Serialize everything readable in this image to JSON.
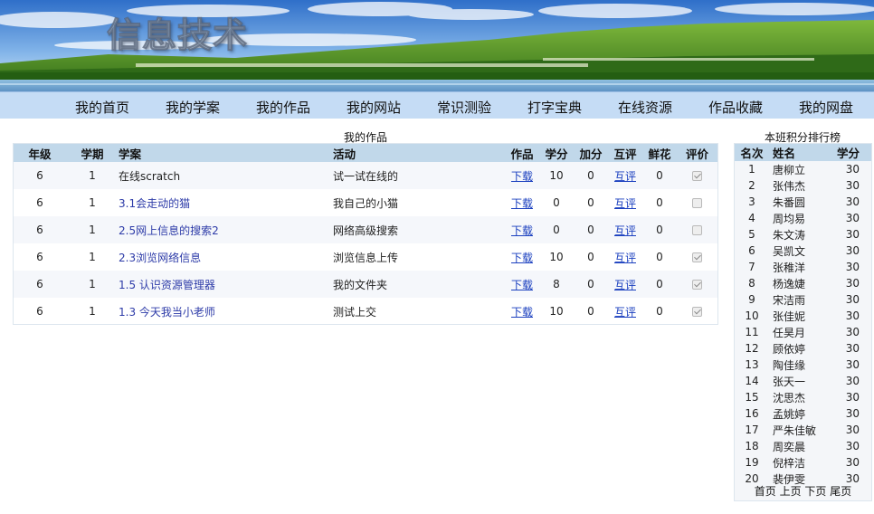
{
  "banner": {
    "title": "信息技术"
  },
  "nav": {
    "items": [
      "我的首页",
      "我的学案",
      "我的作品",
      "我的网站",
      "常识测验",
      "打字宝典",
      "在线资源",
      "作品收藏",
      "我的网盘"
    ]
  },
  "works": {
    "caption": "我的作品",
    "columns": [
      "年级",
      "学期",
      "学案",
      "活动",
      "作品",
      "学分",
      "加分",
      "互评",
      "鲜花",
      "评价"
    ],
    "rows": [
      {
        "grade": "6",
        "term": "1",
        "lesson": "在线scratch",
        "activity": "试一试在线的",
        "download": "下载",
        "credit": "10",
        "bonus": "0",
        "review": "互评",
        "flowers": "0",
        "rated": true
      },
      {
        "grade": "6",
        "term": "1",
        "lesson": "3.1会走动的猫",
        "activity": "我自己的小猫",
        "download": "下载",
        "credit": "0",
        "bonus": "0",
        "review": "互评",
        "flowers": "0",
        "rated": false
      },
      {
        "grade": "6",
        "term": "1",
        "lesson": "2.5网上信息的搜索2",
        "activity": "网络高级搜索",
        "download": "下载",
        "credit": "0",
        "bonus": "0",
        "review": "互评",
        "flowers": "0",
        "rated": false
      },
      {
        "grade": "6",
        "term": "1",
        "lesson": "2.3浏览网络信息",
        "activity": "浏览信息上传",
        "download": "下载",
        "credit": "10",
        "bonus": "0",
        "review": "互评",
        "flowers": "0",
        "rated": true
      },
      {
        "grade": "6",
        "term": "1",
        "lesson": "1.5 认识资源管理器",
        "activity": "我的文件夹",
        "download": "下载",
        "credit": "8",
        "bonus": "0",
        "review": "互评",
        "flowers": "0",
        "rated": true
      },
      {
        "grade": "6",
        "term": "1",
        "lesson": "1.3 今天我当小老师",
        "activity": "测试上交",
        "download": "下载",
        "credit": "10",
        "bonus": "0",
        "review": "互评",
        "flowers": "0",
        "rated": true
      }
    ]
  },
  "ranking": {
    "caption": "本班积分排行榜",
    "columns": [
      "名次",
      "姓名",
      "学分"
    ],
    "rows": [
      {
        "rank": "1",
        "name": "唐柳立",
        "score": "30"
      },
      {
        "rank": "2",
        "name": "张伟杰",
        "score": "30"
      },
      {
        "rank": "3",
        "name": "朱番圆",
        "score": "30"
      },
      {
        "rank": "4",
        "name": "周均易",
        "score": "30"
      },
      {
        "rank": "5",
        "name": "朱文涛",
        "score": "30"
      },
      {
        "rank": "6",
        "name": "吴凯文",
        "score": "30"
      },
      {
        "rank": "7",
        "name": "张稚洋",
        "score": "30"
      },
      {
        "rank": "8",
        "name": "杨逸婕",
        "score": "30"
      },
      {
        "rank": "9",
        "name": "宋洁雨",
        "score": "30"
      },
      {
        "rank": "10",
        "name": "张佳妮",
        "score": "30"
      },
      {
        "rank": "11",
        "name": "任昊月",
        "score": "30"
      },
      {
        "rank": "12",
        "name": "顾依婷",
        "score": "30"
      },
      {
        "rank": "13",
        "name": "陶佳缘",
        "score": "30"
      },
      {
        "rank": "14",
        "name": "张天一",
        "score": "30"
      },
      {
        "rank": "15",
        "name": "沈思杰",
        "score": "30"
      },
      {
        "rank": "16",
        "name": "孟姚婷",
        "score": "30"
      },
      {
        "rank": "17",
        "name": "严朱佳敏",
        "score": "30"
      },
      {
        "rank": "18",
        "name": "周奕晨",
        "score": "30"
      },
      {
        "rank": "19",
        "name": "倪梓洁",
        "score": "30"
      },
      {
        "rank": "20",
        "name": "裴伊雯",
        "score": "30"
      }
    ],
    "pager": {
      "first": "首页",
      "prev": "上页",
      "next": "下页",
      "last": "尾页"
    }
  },
  "colors": {
    "nav_bg": "#c5dcf5",
    "header_bg": "#c1d8ea",
    "link": "#1a3fbf"
  }
}
